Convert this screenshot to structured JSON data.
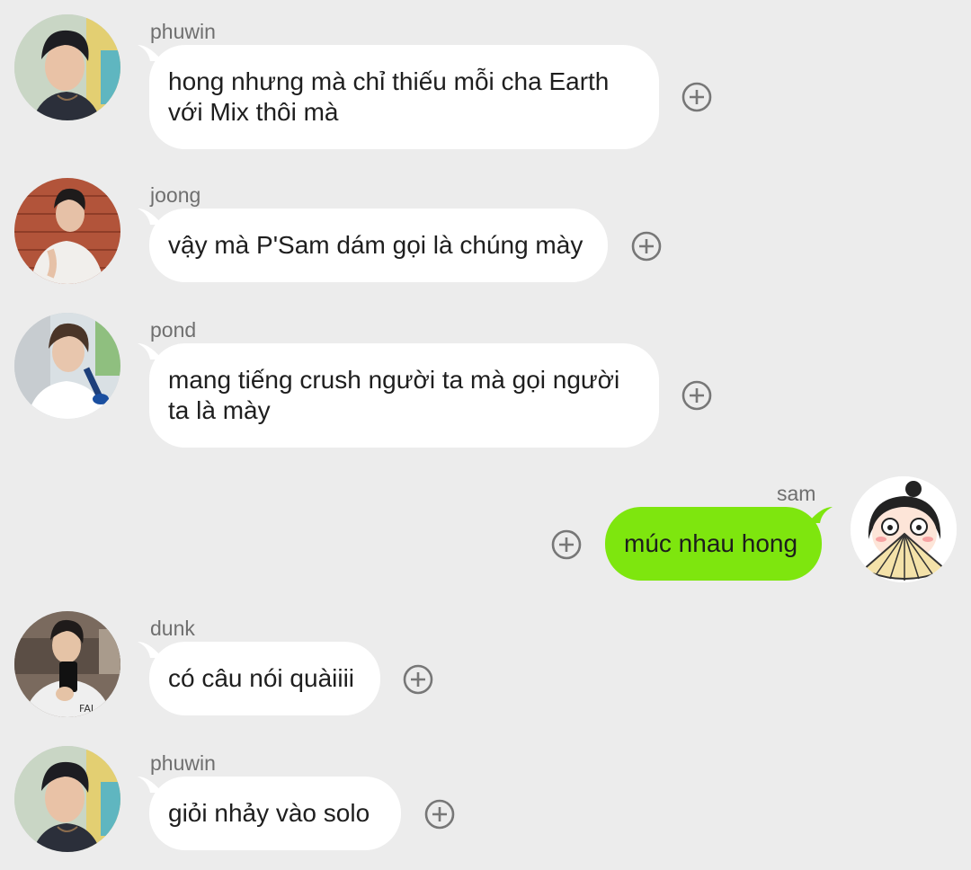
{
  "messages": [
    {
      "sender": "phuwin",
      "text": "hong nhưng mà chỉ thiếu mỗi cha Earth với Mix thôi mà",
      "mine": false,
      "avatar": "phuwin-avatar"
    },
    {
      "sender": "joong",
      "text": "vậy mà P'Sam dám gọi là chúng mày",
      "mine": false,
      "avatar": "joong-avatar"
    },
    {
      "sender": "pond",
      "text": "mang tiếng crush người ta mà gọi người ta là mày",
      "mine": false,
      "avatar": "pond-avatar"
    },
    {
      "sender": "sam",
      "text": "múc nhau hong",
      "mine": true,
      "avatar": "sam-avatar"
    },
    {
      "sender": "dunk",
      "text": "có câu nói quàiiii",
      "mine": false,
      "avatar": "dunk-avatar"
    },
    {
      "sender": "phuwin",
      "text": "giỏi nhảy vào solo",
      "mine": false,
      "avatar": "phuwin-avatar"
    }
  ],
  "colors": {
    "background": "#ececec",
    "incoming_bubble": "#ffffff",
    "outgoing_bubble": "#7ee60e",
    "sender_name": "#6f6f6f",
    "add_icon": "#777777"
  },
  "icons": {
    "add_reaction": "plus-circle-icon"
  }
}
